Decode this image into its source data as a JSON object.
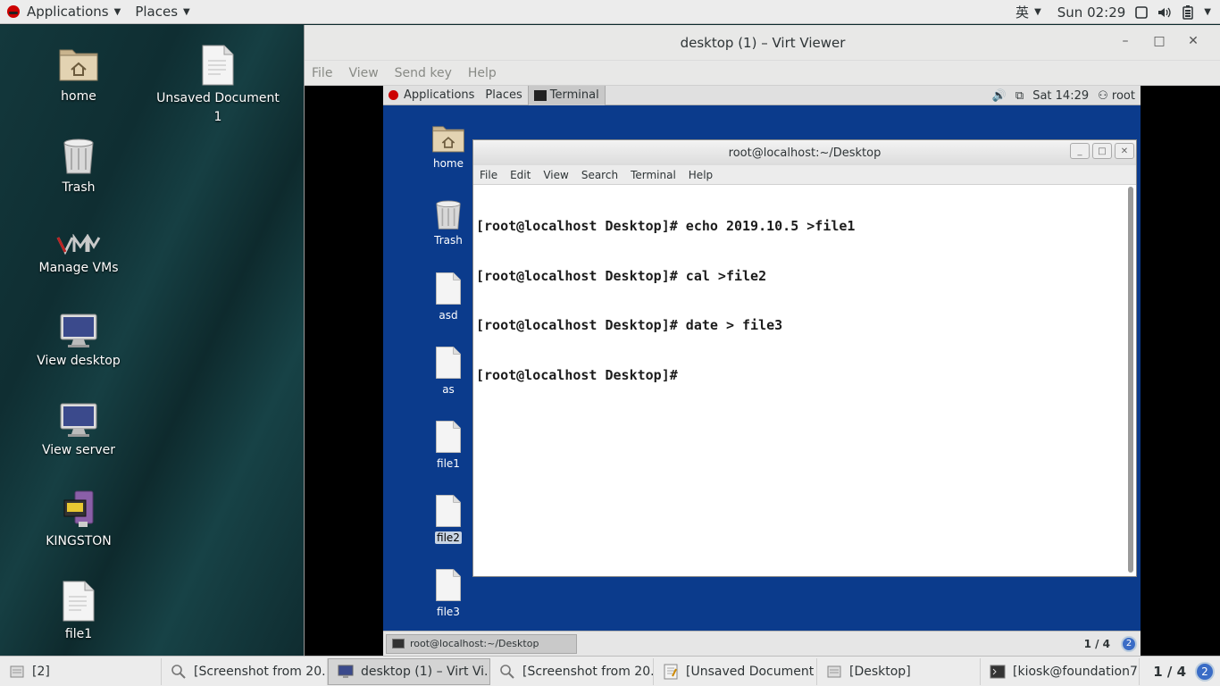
{
  "host_topbar": {
    "applications": "Applications",
    "places": "Places",
    "input_method": "英",
    "clock": "Sun 02:29"
  },
  "host_desktop": {
    "icons": [
      {
        "label": "home",
        "icon": "folder-home-icon"
      },
      {
        "label": "Unsaved Document 1",
        "icon": "document-icon"
      },
      {
        "label": "Trash",
        "icon": "trash-icon"
      },
      {
        "label": "Manage VMs",
        "icon": "virt-manager-icon"
      },
      {
        "label": "View desktop",
        "icon": "monitor-icon"
      },
      {
        "label": "View server",
        "icon": "monitor-icon"
      },
      {
        "label": "KINGSTON",
        "icon": "usb-drive-icon"
      },
      {
        "label": "file1",
        "icon": "document-icon"
      }
    ]
  },
  "virt_viewer": {
    "title": "desktop (1) – Virt Viewer",
    "menu": [
      "File",
      "View",
      "Send key",
      "Help"
    ]
  },
  "guest": {
    "topbar": {
      "applications": "Applications",
      "places": "Places",
      "active_app": "Terminal",
      "clock": "Sat 14:29",
      "user": "root"
    },
    "desktop_icons": [
      {
        "label": "home",
        "icon": "folder-home-icon"
      },
      {
        "label": "Trash",
        "icon": "trash-icon"
      },
      {
        "label": "asd",
        "icon": "document-icon"
      },
      {
        "label": "as",
        "icon": "document-icon"
      },
      {
        "label": "file1",
        "icon": "document-icon"
      },
      {
        "label": "file2",
        "icon": "document-icon",
        "selected": true
      },
      {
        "label": "file3",
        "icon": "document-icon"
      }
    ],
    "terminal": {
      "title": "root@localhost:~/Desktop",
      "menu": [
        "File",
        "Edit",
        "View",
        "Search",
        "Terminal",
        "Help"
      ],
      "lines": [
        "[root@localhost Desktop]# echo 2019.10.5 >file1",
        "[root@localhost Desktop]# cal >file2",
        "[root@localhost Desktop]# date > file3",
        "[root@localhost Desktop]# "
      ]
    },
    "taskbar": {
      "task": "root@localhost:~/Desktop",
      "workspace": "1 / 4",
      "badge": "2"
    }
  },
  "host_taskbar": {
    "items": [
      {
        "label": "[2]",
        "icon": "window-list-icon",
        "active": false
      },
      {
        "label": "[Screenshot from 20...",
        "icon": "screenshot-icon",
        "active": false
      },
      {
        "label": "desktop (1) – Virt Vi...",
        "icon": "monitor-icon",
        "active": true
      },
      {
        "label": "[Screenshot from 20...",
        "icon": "screenshot-icon",
        "active": false
      },
      {
        "label": "[Unsaved Document ...",
        "icon": "text-editor-icon",
        "active": false
      },
      {
        "label": "[Desktop]",
        "icon": "folder-icon",
        "active": false
      },
      {
        "label": "[kiosk@foundation7...",
        "icon": "terminal-icon",
        "active": false
      }
    ],
    "workspace": "1 / 4",
    "badge": "2"
  }
}
